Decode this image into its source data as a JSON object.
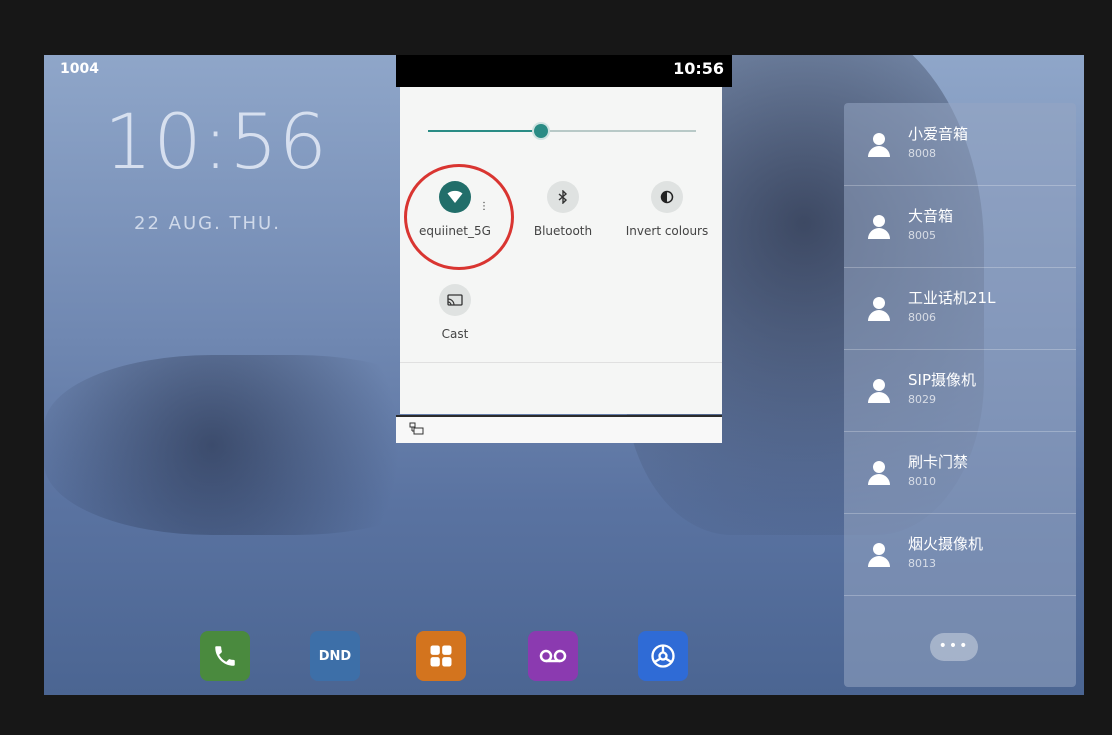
{
  "status_bar": {
    "time": "10:56"
  },
  "home": {
    "extension": "1004",
    "clock": "10:56",
    "date": "22 AUG. THU."
  },
  "quick_settings": {
    "brightness_level": 0.42,
    "accent_color": "#2a8c85",
    "tiles": [
      {
        "label": "equiinet_5G",
        "icon": "wifi-icon",
        "active": true
      },
      {
        "label": "Bluetooth",
        "icon": "bluetooth-icon",
        "active": false
      },
      {
        "label": "Invert colours",
        "icon": "invert-colours-icon",
        "active": false
      },
      {
        "label": "Cast",
        "icon": "cast-icon",
        "active": false
      }
    ]
  },
  "contacts": [
    {
      "name": "小爱音箱",
      "number": "8008"
    },
    {
      "name": "大音箱",
      "number": "8005"
    },
    {
      "name": "工业话机21L",
      "number": "8006"
    },
    {
      "name": "SIP摄像机",
      "number": "8029"
    },
    {
      "name": "刷卡门禁",
      "number": "8010"
    },
    {
      "name": "烟火摄像机",
      "number": "8013"
    }
  ],
  "more_label": "•••",
  "dock": {
    "phone_icon": "phone-icon",
    "dnd_label": "DND",
    "apps_icon": "apps-grid-icon",
    "voicemail_icon": "voicemail-icon",
    "settings_icon": "settings-icon"
  }
}
